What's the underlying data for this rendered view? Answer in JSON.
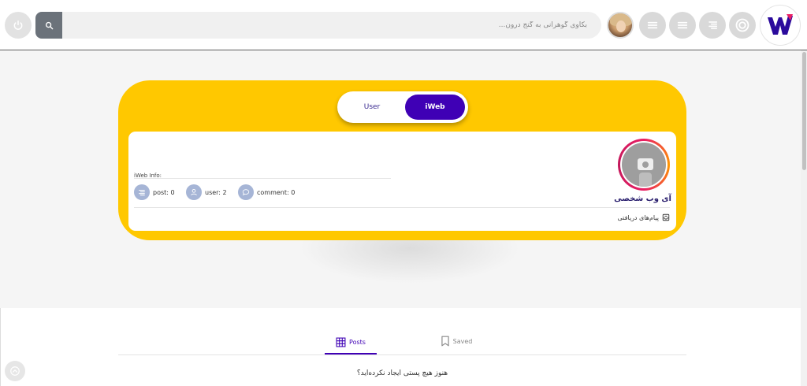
{
  "header": {
    "search_placeholder": "بکاوی گوهرانی به گنج درون...",
    "icons": [
      "power-icon",
      "search-icon",
      "menu-icon",
      "menu-icon",
      "align-right-icon",
      "target-icon"
    ],
    "logo_letter": "W"
  },
  "hero": {
    "toggle": {
      "user_label": "User",
      "iweb_label": "iWeb",
      "active": "iWeb"
    },
    "site_name": "آی وب شخصی",
    "info_label": "iWeb Info:",
    "stats": [
      {
        "label": "post: 0",
        "icon": "list-icon"
      },
      {
        "label": "user: 2",
        "icon": "user-icon"
      },
      {
        "label": "comment: 0",
        "icon": "comment-icon"
      }
    ],
    "inbox_label": "پیام‌های دریافتی",
    "colors": {
      "card": "#ffc800",
      "accent": "#3f00b5"
    }
  },
  "content": {
    "tabs": [
      {
        "label": "Posts",
        "icon": "grid-icon",
        "active": true
      },
      {
        "label": "Saved",
        "icon": "bookmark-icon",
        "active": false
      }
    ],
    "empty_message": "هنوز هیچ پستی ایجاد نکرده‌اید؟"
  }
}
